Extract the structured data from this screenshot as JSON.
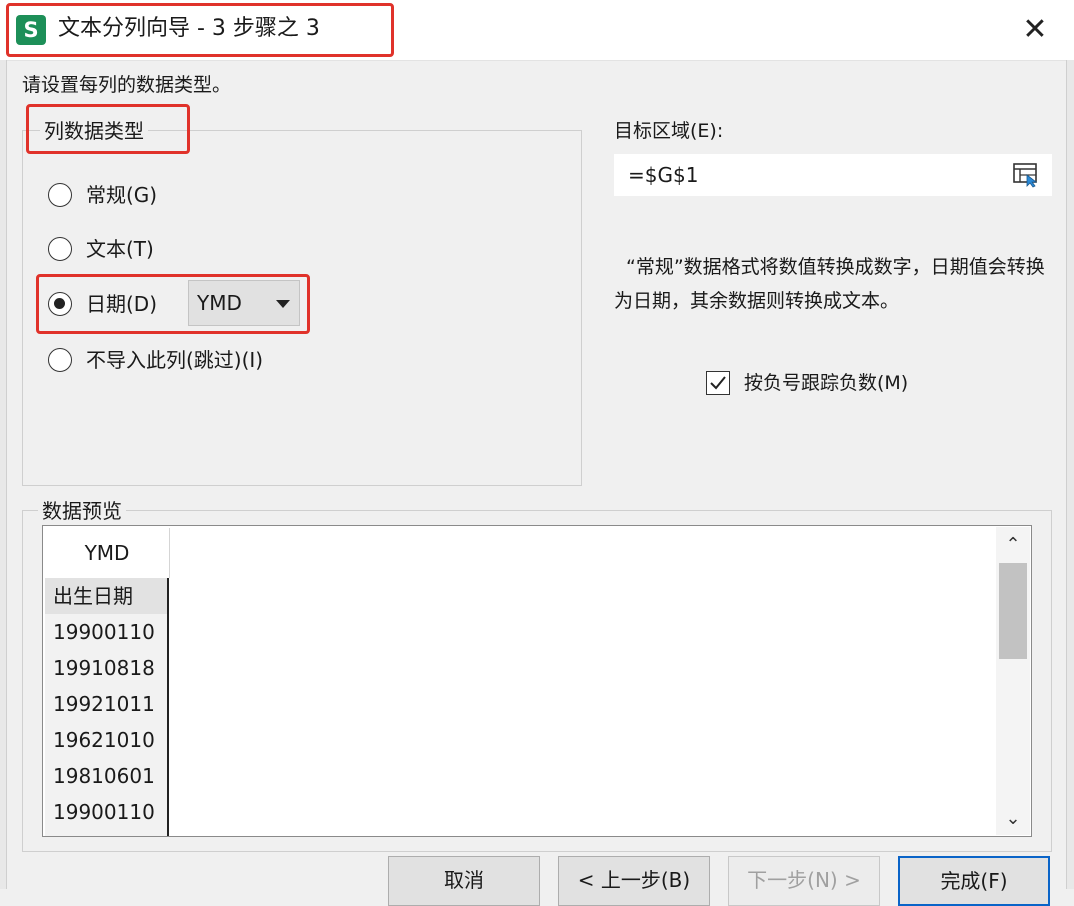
{
  "window": {
    "title": "文本分列向导 - 3 步骤之 3",
    "app_icon_letter": "S",
    "app_icon_color": "#1d8f58",
    "close_symbol": "✕"
  },
  "instruction": "请设置每列的数据类型。",
  "column_type": {
    "legend": "列数据类型",
    "options": [
      {
        "label": "常规(G)",
        "checked": false
      },
      {
        "label": "文本(T)",
        "checked": false
      },
      {
        "label": "日期(D)",
        "checked": true
      },
      {
        "label": "不导入此列(跳过)(I)",
        "checked": false
      }
    ],
    "date_format": "YMD"
  },
  "target": {
    "label": "目标区域(E):",
    "value": "=$G$1",
    "icon": "range-picker-icon"
  },
  "description": "“常规”数据格式将数值转换成数字，日期值会转换为日期，其余数据则转换成文本。",
  "negative_tracking": {
    "label": "按负号跟踪负数(M)",
    "checked": true
  },
  "preview": {
    "legend": "数据预览",
    "column_header": "YMD",
    "rows": [
      "出生日期",
      "19900110",
      "19910818",
      "19921011",
      "19621010",
      "19810601",
      "19900110"
    ]
  },
  "buttons": {
    "cancel": "取消",
    "back": "< 上一步(B)",
    "next": "下一步(N) >",
    "finish": "完成(F)"
  },
  "colors": {
    "highlight": "#e0322a",
    "primary_border": "#0a64c8"
  }
}
